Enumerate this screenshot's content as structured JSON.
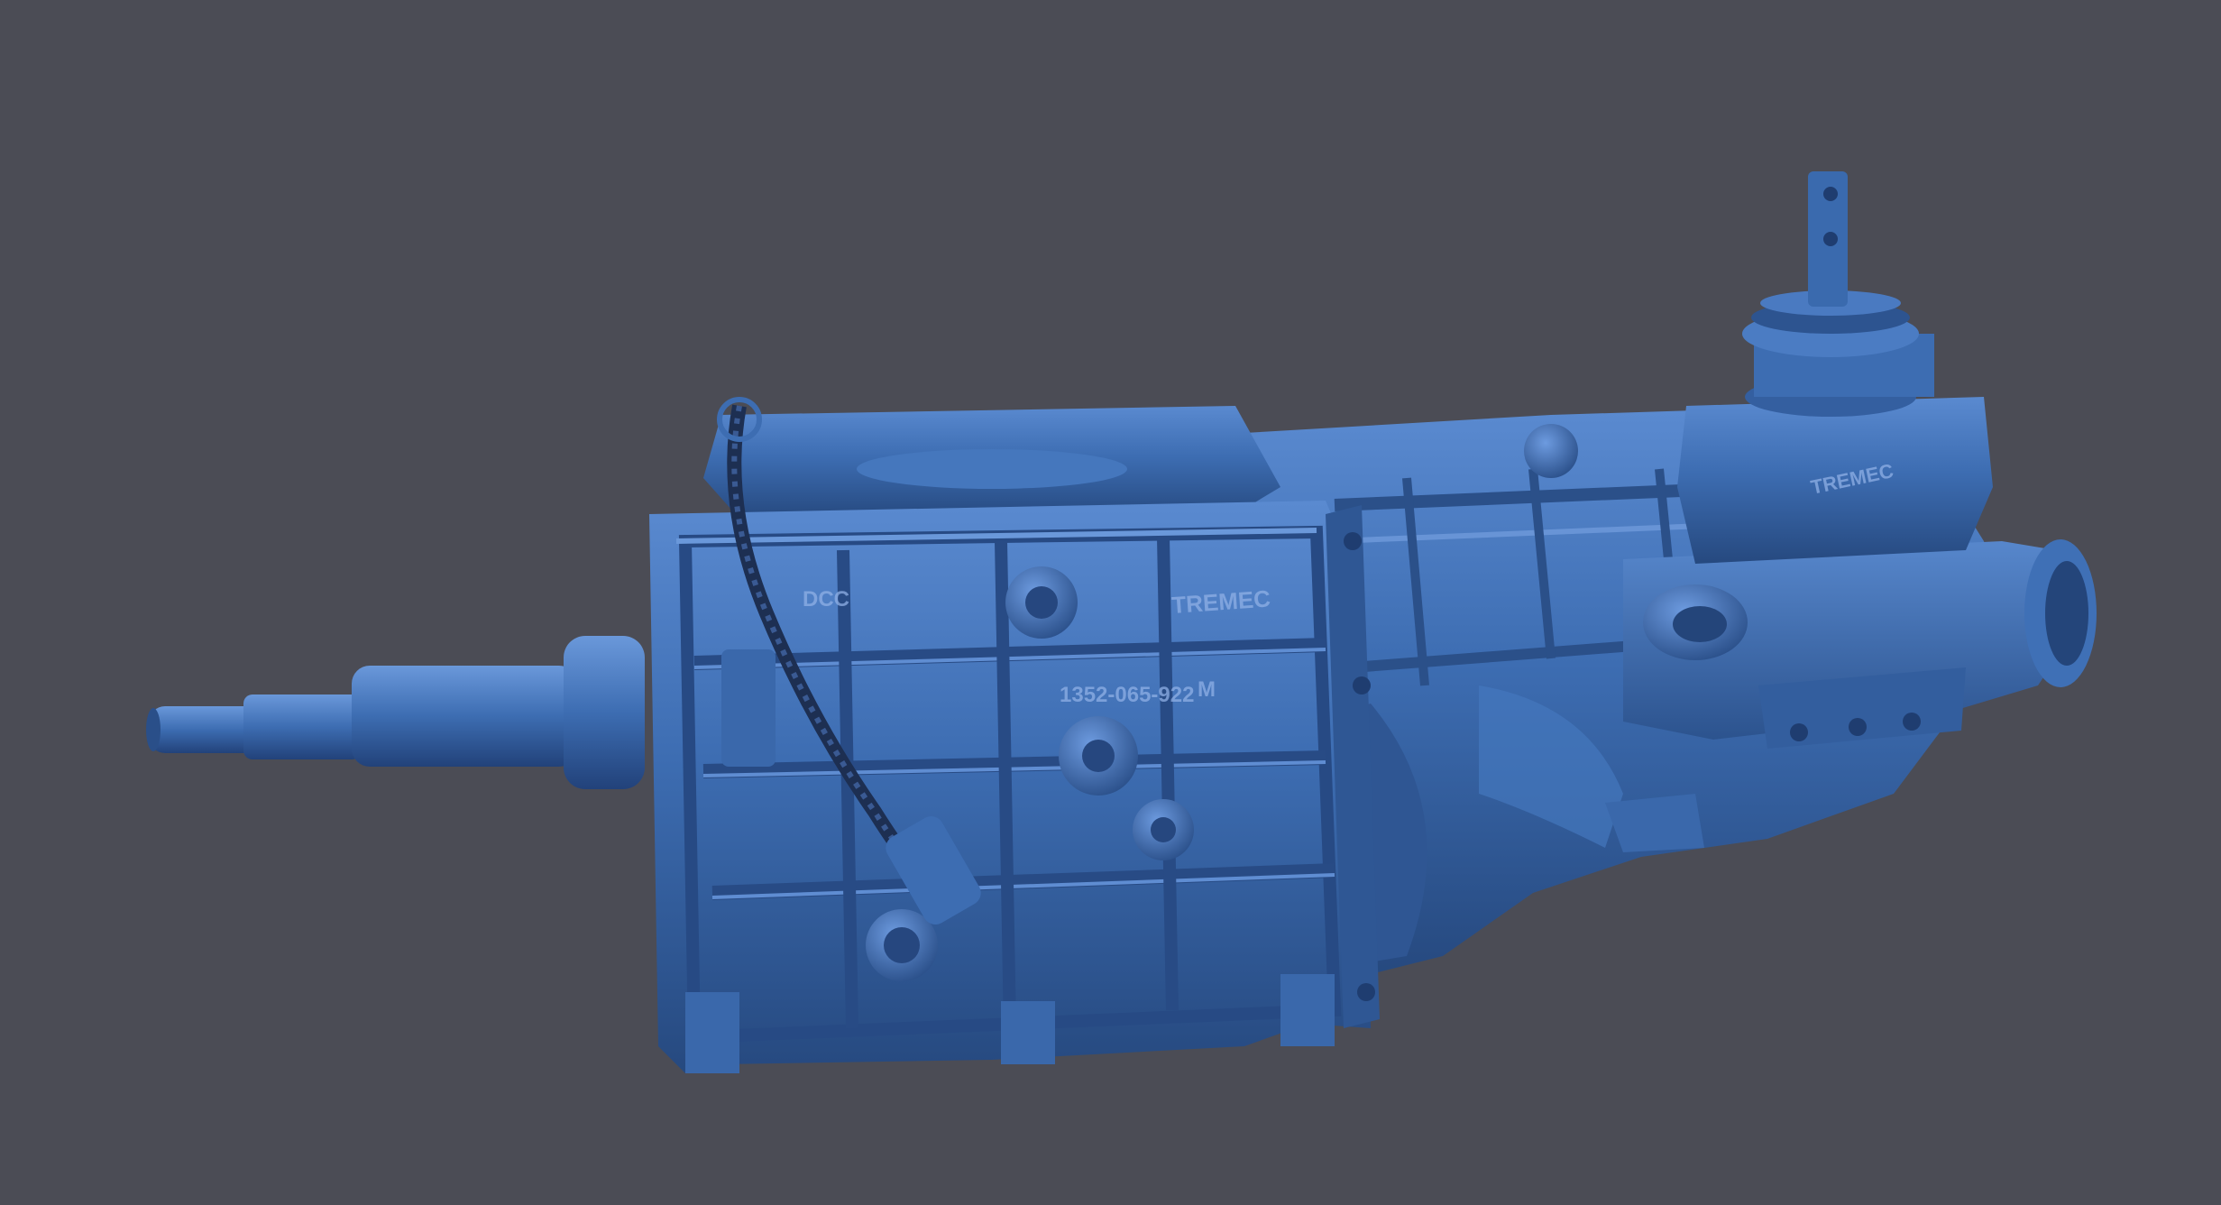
{
  "scene": {
    "background_color": "#4b4c55",
    "model_color": "#3d6db2",
    "model_highlight": "#5a8ad0",
    "model_shadow": "#24457a",
    "subject": "transmission-3d-scan"
  },
  "markings": {
    "brand_front": "TREMEC",
    "brand_rear": "TREMEC",
    "part_number": "1352-065-922",
    "part_suffix": "M",
    "stamp": "DCC"
  }
}
